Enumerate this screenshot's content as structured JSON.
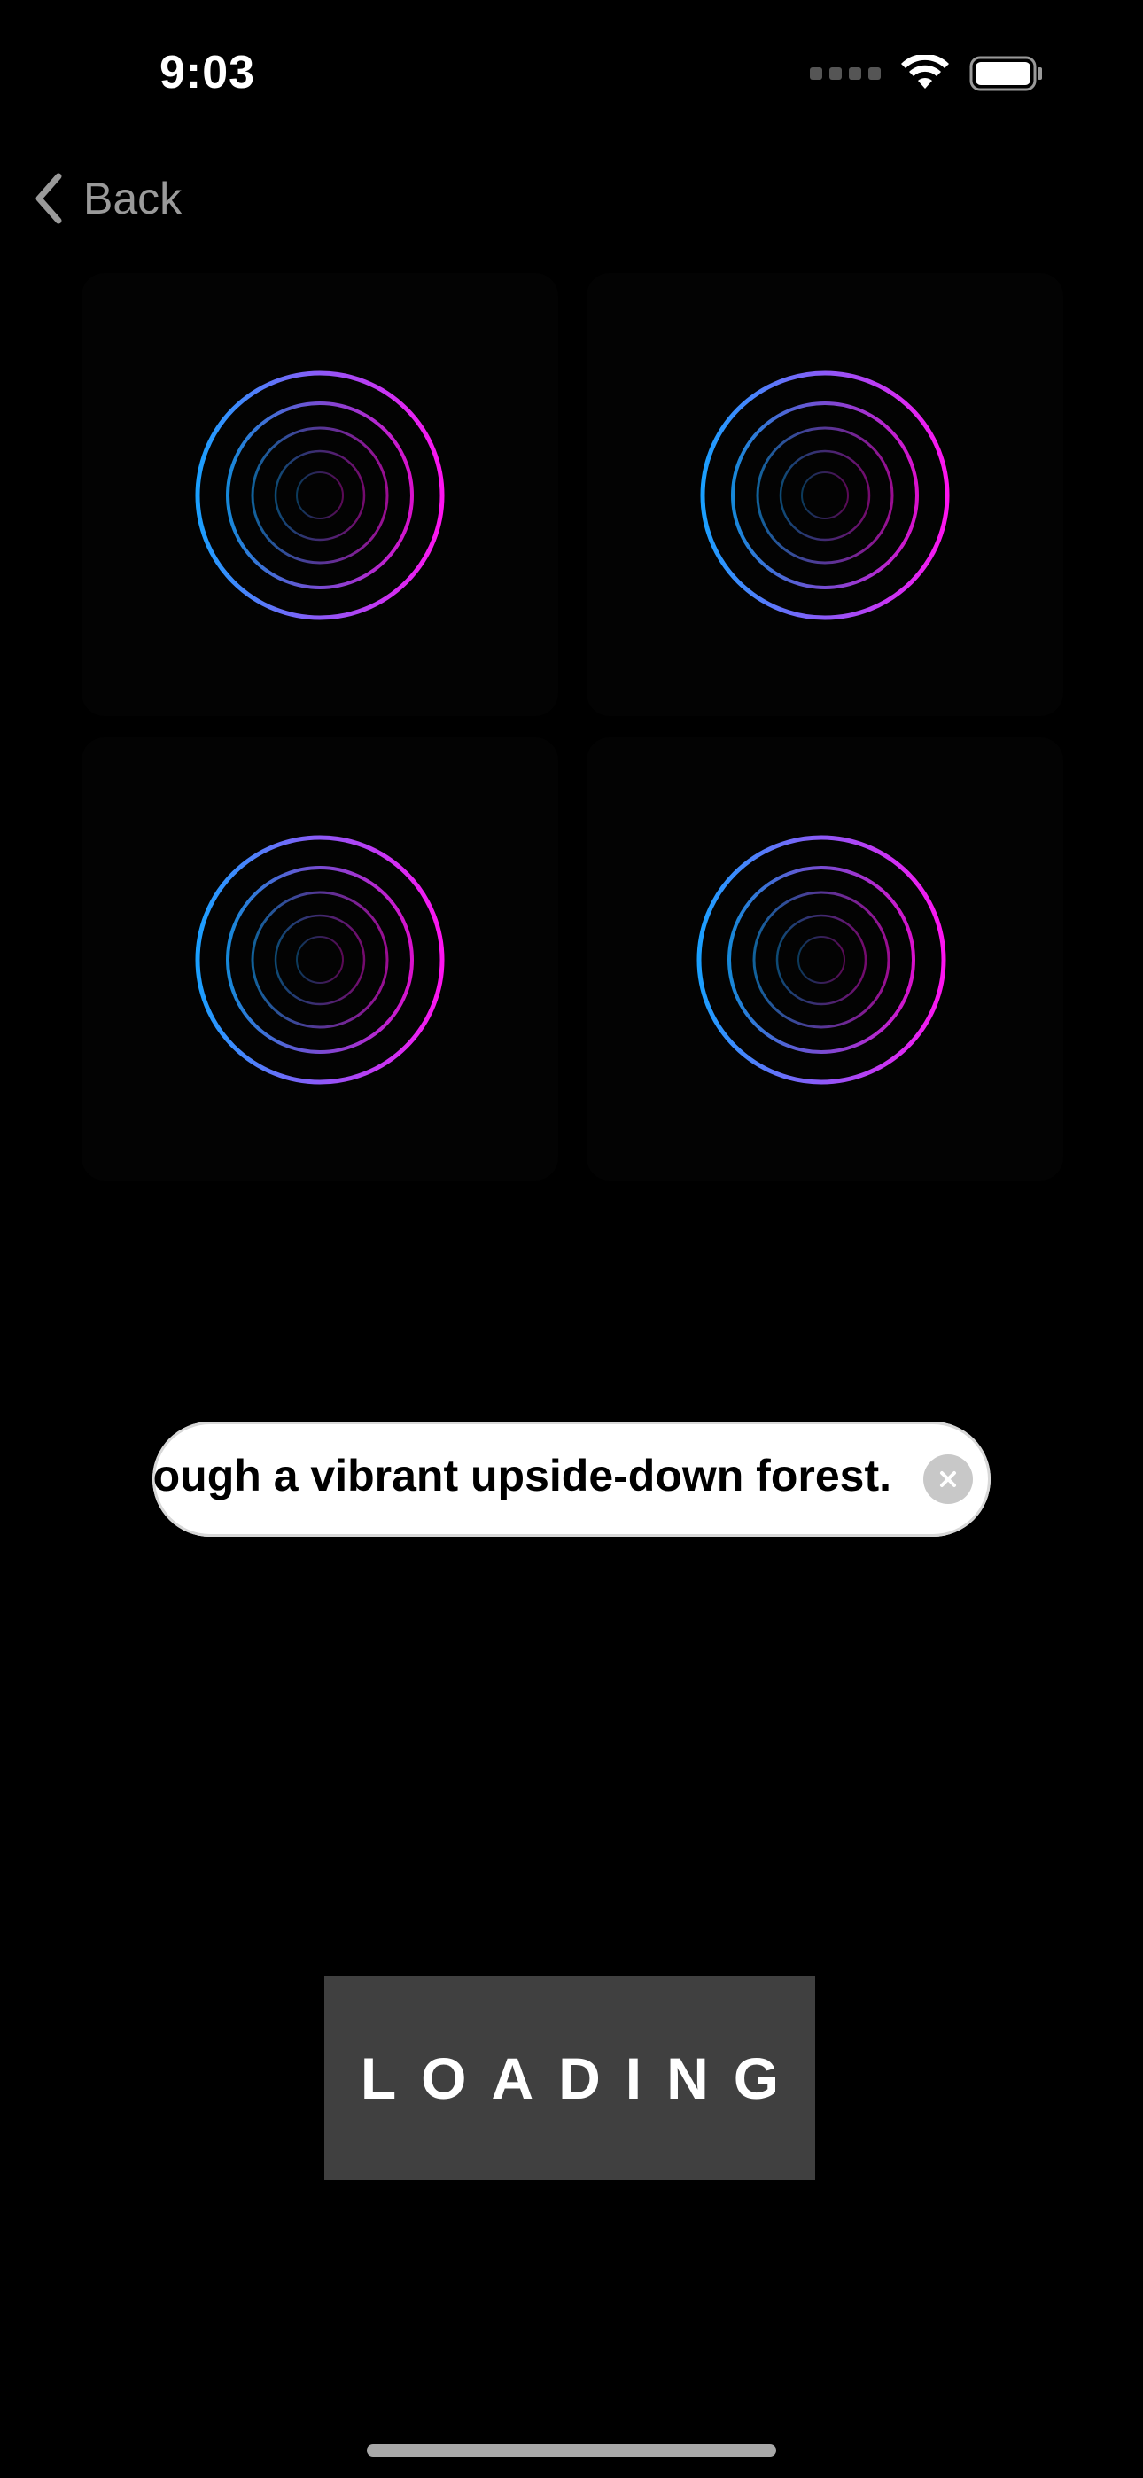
{
  "status_bar": {
    "time": "9:03",
    "icons": [
      "cellular-signal-icon",
      "wifi-icon",
      "battery-icon"
    ]
  },
  "nav": {
    "back_label": "Back",
    "back_icon": "chevron-left-icon"
  },
  "grid": {
    "tiles": [
      {
        "icon": "concentric-rings-icon"
      },
      {
        "icon": "concentric-rings-icon"
      },
      {
        "icon": "concentric-rings-icon"
      },
      {
        "icon": "concentric-rings-icon"
      }
    ]
  },
  "prompt": {
    "text": "Walking through a vibrant upside-down forest.",
    "clear_icon": "clear-circle-icon"
  },
  "loading_button": {
    "label": "LOADING"
  },
  "colors": {
    "background": "#000000",
    "ring_gradient_start": "#1aa0ff",
    "ring_gradient_end": "#ff14f0",
    "loading_bg": "#404040"
  }
}
